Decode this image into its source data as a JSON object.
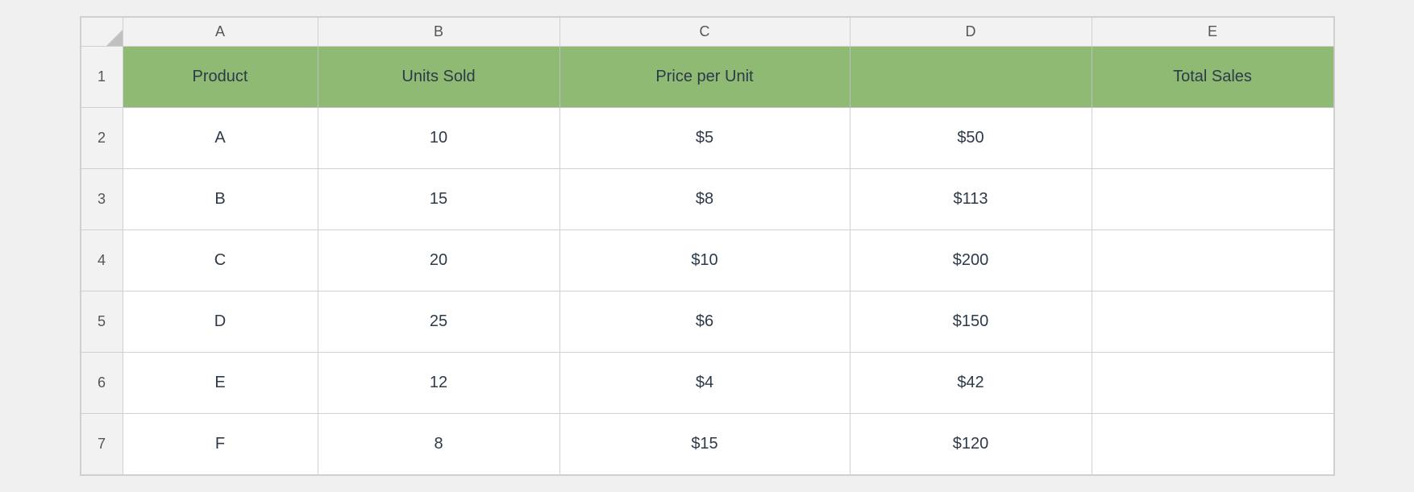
{
  "columns": {
    "letters": [
      "A",
      "B",
      "C",
      "D",
      "E"
    ]
  },
  "header_row": {
    "row_num": "1",
    "cells": [
      {
        "label": "Product",
        "empty": false
      },
      {
        "label": "Units Sold",
        "empty": false
      },
      {
        "label": "Price per Unit",
        "empty": false
      },
      {
        "label": "",
        "empty": true
      },
      {
        "label": "Total Sales",
        "empty": false
      }
    ]
  },
  "data_rows": [
    {
      "row_num": "2",
      "cells": [
        "A",
        "10",
        "$5",
        "$50",
        ""
      ]
    },
    {
      "row_num": "3",
      "cells": [
        "B",
        "15",
        "$8",
        "$113",
        ""
      ]
    },
    {
      "row_num": "4",
      "cells": [
        "C",
        "20",
        "$10",
        "$200",
        ""
      ]
    },
    {
      "row_num": "5",
      "cells": [
        "D",
        "25",
        "$6",
        "$150",
        ""
      ]
    },
    {
      "row_num": "6",
      "cells": [
        "E",
        "12",
        "$4",
        "$42",
        ""
      ]
    },
    {
      "row_num": "7",
      "cells": [
        "F",
        "8",
        "$15",
        "$120",
        ""
      ]
    }
  ]
}
